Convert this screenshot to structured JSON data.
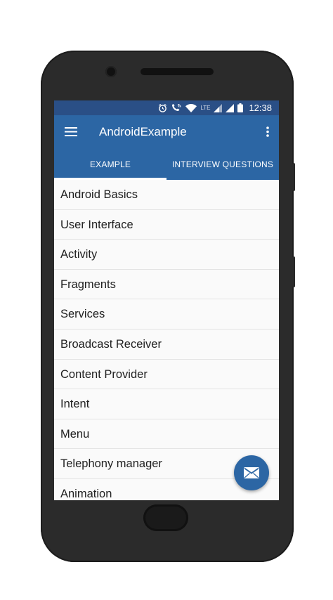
{
  "status_bar": {
    "time": "12:38",
    "icons": [
      "alarm-icon",
      "wifi-call-icon",
      "wifi-icon",
      "lte-signal-icon",
      "signal-icon",
      "battery-icon"
    ],
    "network_label": "LTE"
  },
  "app_bar": {
    "title": "AndroidExample",
    "menu_icon": "hamburger-menu-icon",
    "more_icon": "more-vertical-icon"
  },
  "tabs": [
    {
      "label": "EXAMPLE",
      "selected": true
    },
    {
      "label": "INTERVIEW QUESTIONS",
      "selected": false
    }
  ],
  "list": {
    "items": [
      {
        "label": "Android Basics"
      },
      {
        "label": "User Interface"
      },
      {
        "label": "Activity"
      },
      {
        "label": "Fragments"
      },
      {
        "label": "Services"
      },
      {
        "label": "Broadcast Receiver"
      },
      {
        "label": "Content Provider"
      },
      {
        "label": "Intent"
      },
      {
        "label": "Menu"
      },
      {
        "label": "Telephony manager"
      },
      {
        "label": "Animation"
      }
    ]
  },
  "fab": {
    "icon": "mail-icon"
  },
  "colors": {
    "status_bar": "#2a4f86",
    "primary": "#2c66a4",
    "tab_indicator": "#ffffff",
    "phone_body": "#2b2b2b"
  }
}
